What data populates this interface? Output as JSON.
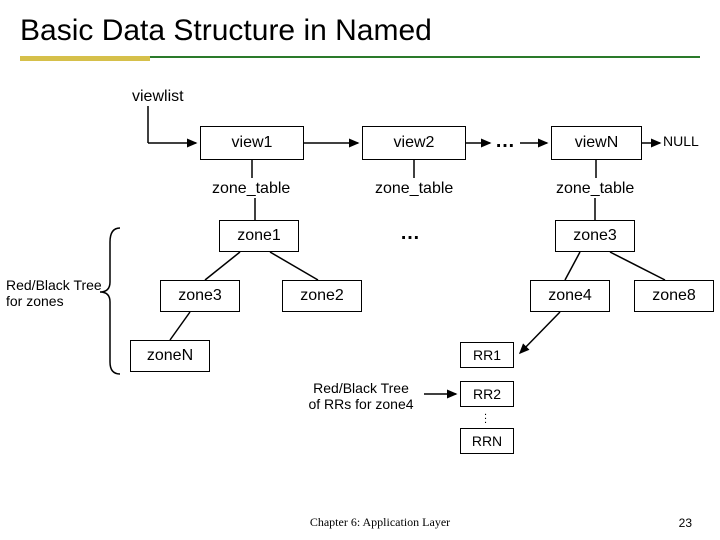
{
  "title": "Basic Data Structure in Named",
  "labels": {
    "viewlist": "viewlist",
    "view1": "view1",
    "view2": "view2",
    "viewN": "viewN",
    "null": "NULL",
    "zone_table1": "zone_table",
    "zone_table2": "zone_table",
    "zone_table3": "zone_table",
    "zone1": "zone1",
    "zone3_left": "zone3",
    "zone2": "zone2",
    "zoneN": "zoneN",
    "zone3_right": "zone3",
    "zone4": "zone4",
    "zone8": "zone8",
    "rr1": "RR1",
    "rr2": "RR2",
    "rrn": "RRN",
    "ellipsis1": "…",
    "ellipsis2": "…",
    "rb_zones_1": "Red/Black Tree",
    "rb_zones_2": "for zones",
    "rb_rrs_1": "Red/Black Tree",
    "rb_rrs_2": "of RRs for zone4"
  },
  "footer": "Chapter 6: Application Layer",
  "page": "23"
}
